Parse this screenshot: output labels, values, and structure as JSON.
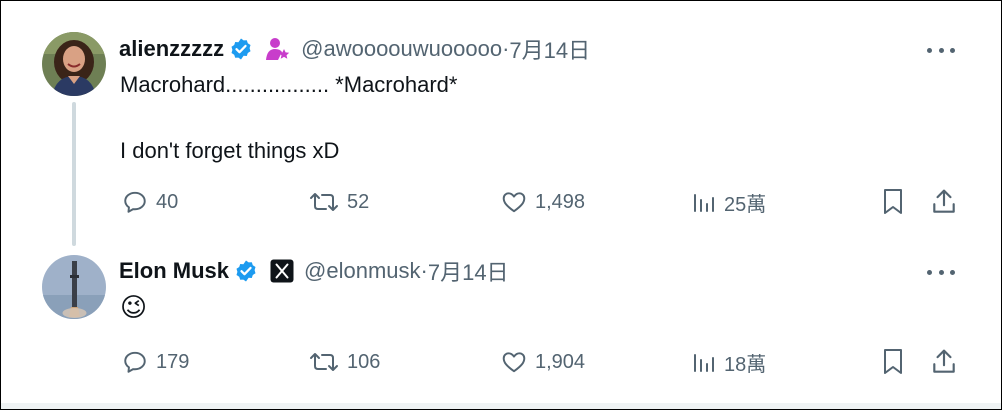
{
  "tweets": [
    {
      "name": "alienzzzzz",
      "handle": "@awoooouwuooooo",
      "separator": " · ",
      "date": "7月14日",
      "text_line1": "Macrohard................. *Macrohard*",
      "text_line2": "I don't forget things xD",
      "icons": {
        "verified": "verified-badge-icon",
        "affiliate": "affiliate-person-star-icon",
        "more": "more-dots-icon"
      },
      "stats": {
        "replies": "40",
        "reposts": "52",
        "likes": "1,498",
        "views": "25萬"
      }
    },
    {
      "name": "Elon Musk",
      "handle": "@elonmusk",
      "separator": " · ",
      "date": "7月14日",
      "text_line1": "😉",
      "icons": {
        "verified": "verified-badge-icon",
        "affiliate": "x-logo-icon",
        "more": "more-dots-icon"
      },
      "stats": {
        "replies": "179",
        "reposts": "106",
        "likes": "1,904",
        "views": "18萬"
      }
    }
  ],
  "colors": {
    "text": "#0f1419",
    "secondary": "#536471",
    "verified": "#1d9bf0",
    "affiliate": "#c83dcb",
    "thread_line": "#cfd9de"
  }
}
